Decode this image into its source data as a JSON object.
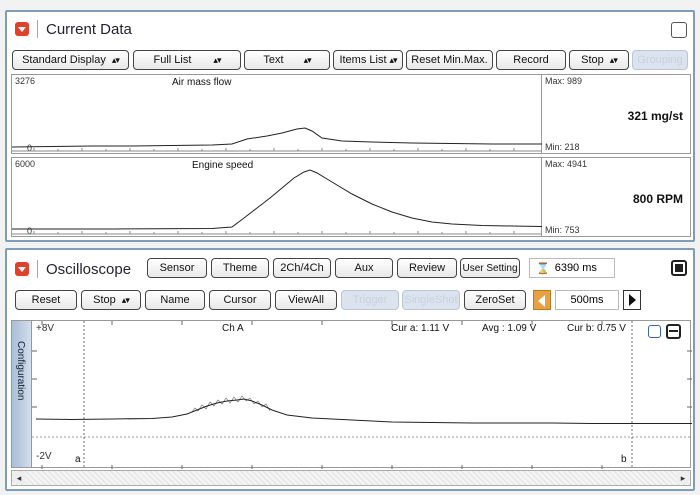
{
  "current": {
    "title": "Current Data",
    "toolbar": {
      "display": "Standard Display",
      "list": "Full List",
      "text": "Text",
      "items": "Items List",
      "reset": "Reset Min.Max.",
      "record": "Record",
      "stop": "Stop",
      "grouping": "Grouping"
    },
    "graphs": [
      {
        "name": "Air mass flow",
        "ymax": "3276",
        "ymin": "0",
        "max": "Max: 989",
        "min": "Min: 218",
        "value": "321 mg/st"
      },
      {
        "name": "Engine speed",
        "ymax": "6000",
        "ymin": "0",
        "max": "Max: 4941",
        "min": "Min: 753",
        "value": "800 RPM"
      }
    ]
  },
  "osc": {
    "title": "Oscilloscope",
    "top_buttons": {
      "sensor": "Sensor",
      "theme": "Theme",
      "channels": "2Ch/4Ch",
      "aux": "Aux",
      "review": "Review",
      "user_setting": "User Setting"
    },
    "time_total": "6390 ms",
    "toolbar": {
      "reset": "Reset",
      "stop": "Stop",
      "name": "Name",
      "cursor": "Cursor",
      "viewall": "ViewAll",
      "trigger": "Trigger",
      "singleshot": "SingleShot",
      "zeroset": "ZeroSet",
      "timebase": "500ms"
    },
    "config_label": "Configuration",
    "channel": "Ch A",
    "ytop": "+8V",
    "ybottom": "-2V",
    "cursor_a": "Cur a: 1.11 V",
    "avg": "Avg  : 1.09 V",
    "cursor_b": "Cur b: 0.75 V",
    "marker_a": "a",
    "marker_b": "b"
  },
  "colors": {
    "panel_border": "#7f9db9",
    "badge": "#e0412a",
    "timebase_arrow": "#e8a040"
  }
}
